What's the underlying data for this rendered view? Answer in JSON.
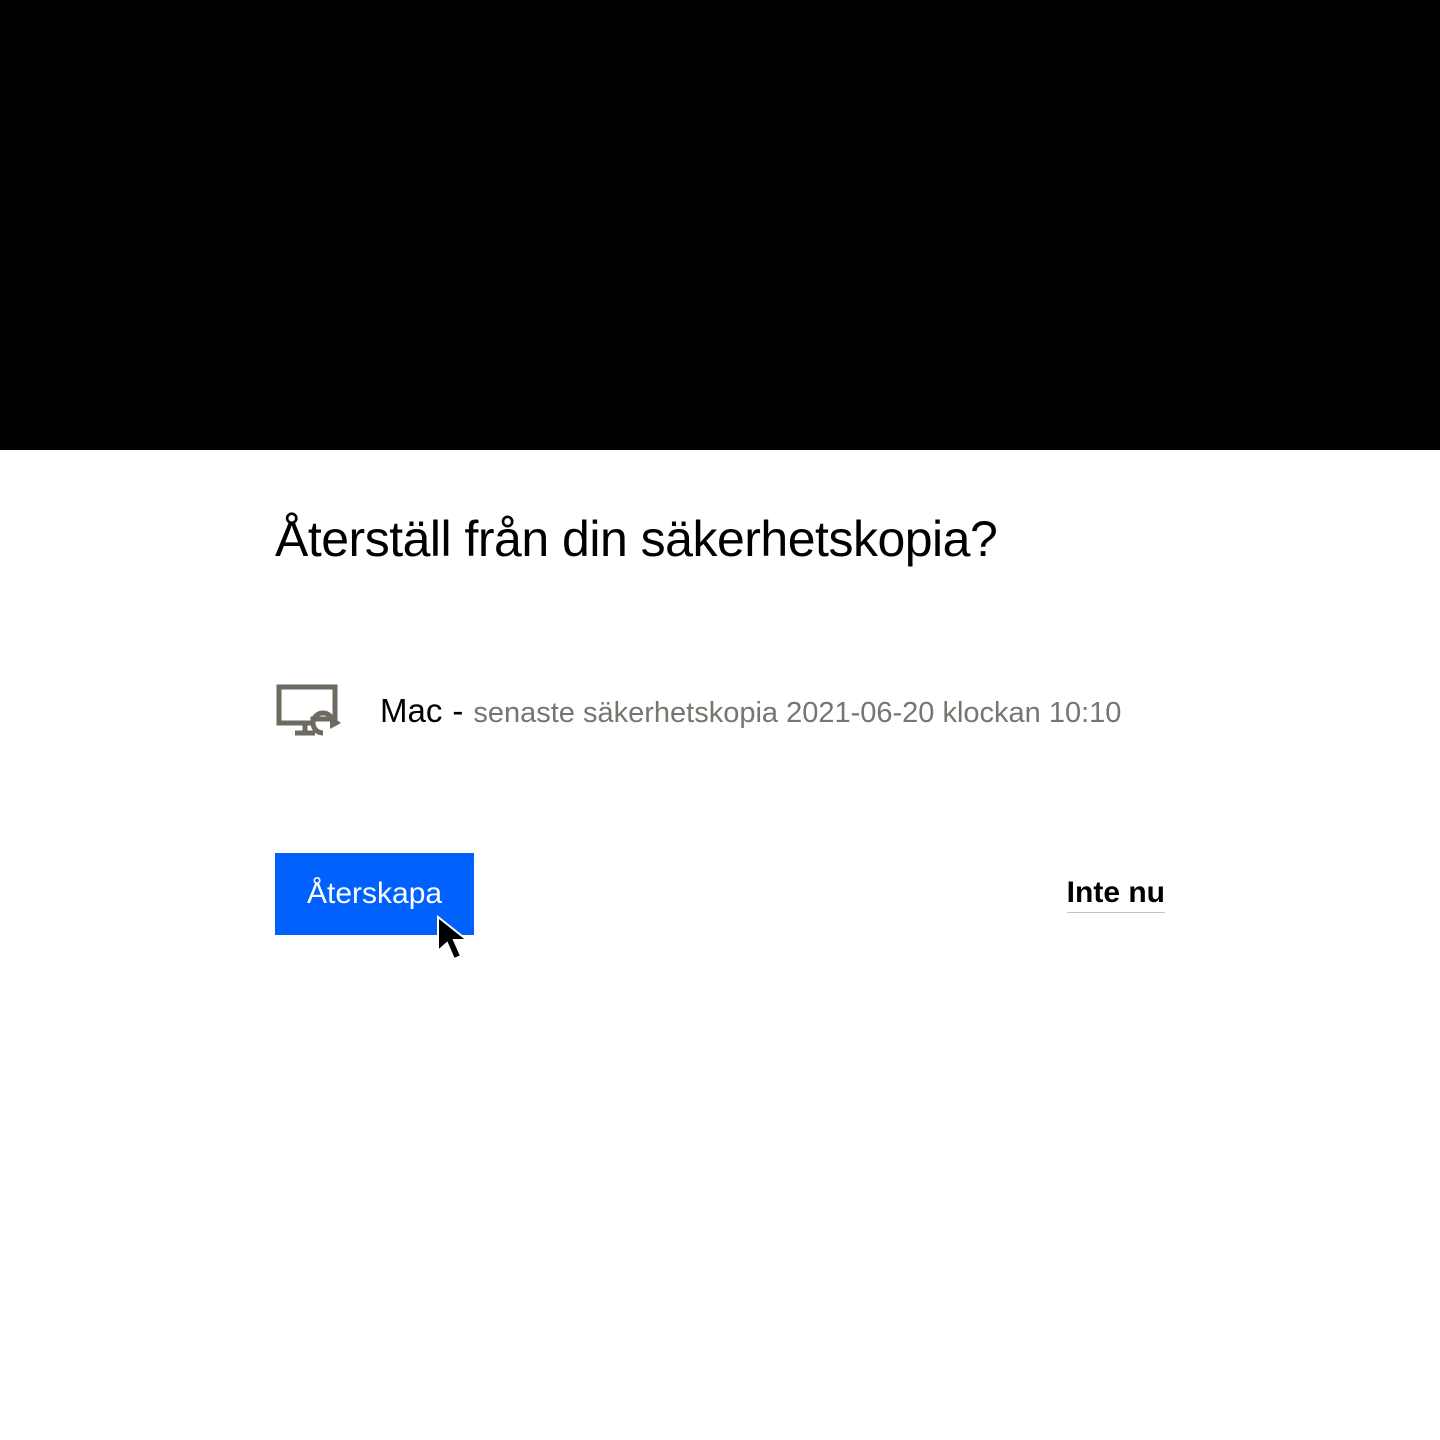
{
  "dialog": {
    "title": "Återställ från din säkerhetskopia?",
    "backup": {
      "device_name": "Mac",
      "separator": "-",
      "detail": "senaste säkerhetskopia 2021-06-20 klockan 10:10"
    },
    "primary_button": "Återskapa",
    "secondary_link": "Inte nu"
  },
  "colors": {
    "primary": "#0061fe",
    "text_muted": "#77756f"
  }
}
